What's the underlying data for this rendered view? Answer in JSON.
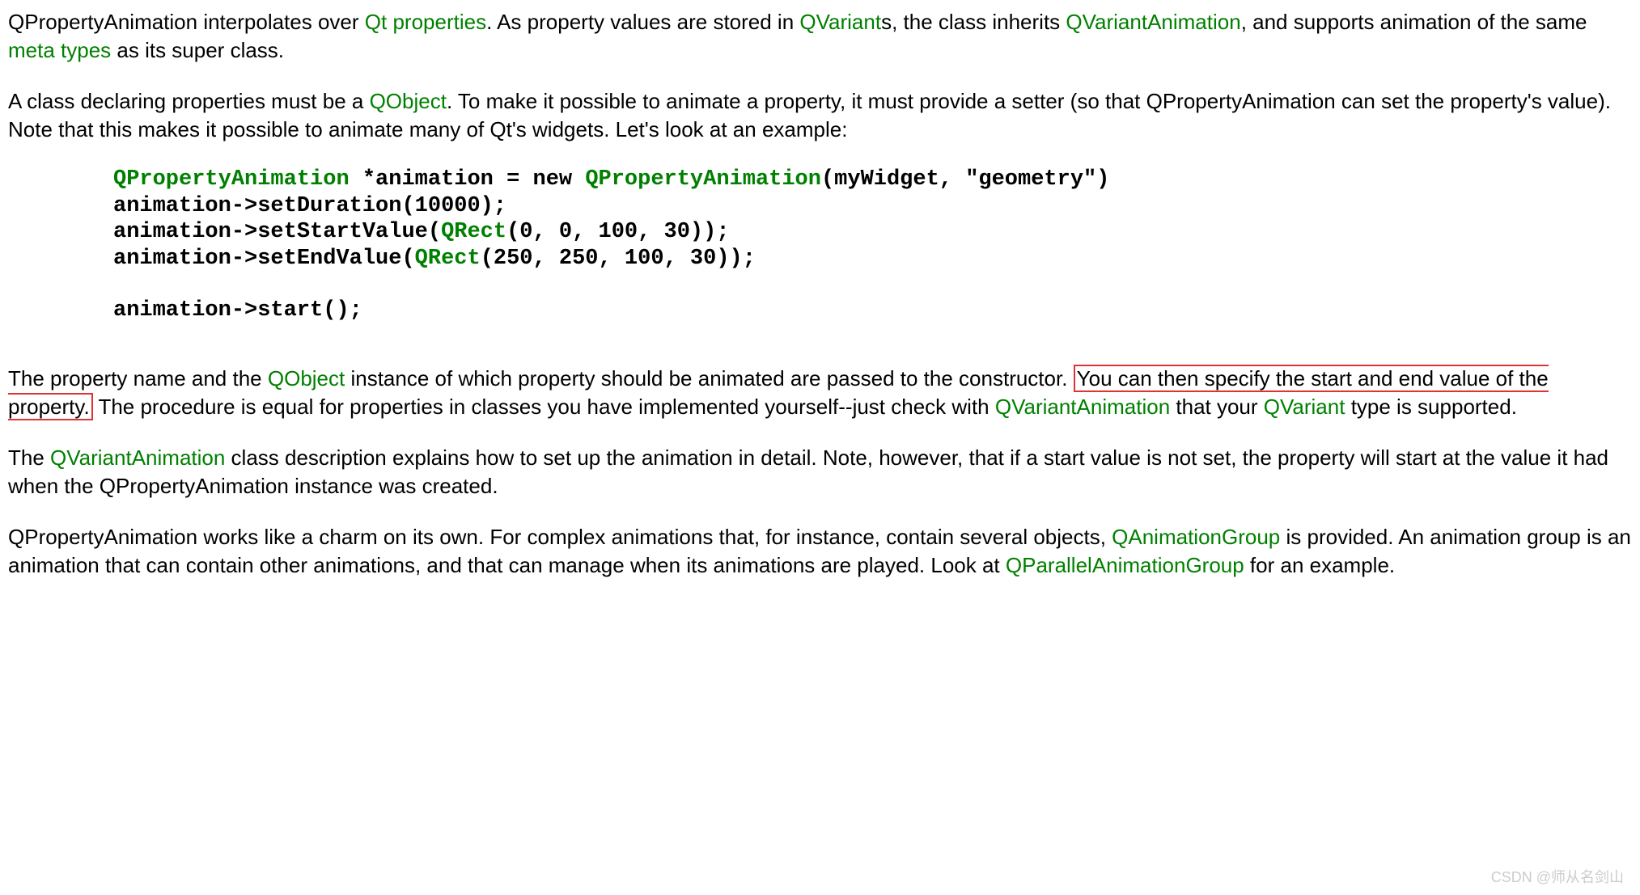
{
  "para1": {
    "t1": "QPropertyAnimation interpolates over ",
    "link1": "Qt properties",
    "t2": ". As property values are stored in ",
    "link2": "QVariant",
    "t3": "s, the class inherits ",
    "link3": "QVariantAnimation",
    "t4": ", and supports animation of the same ",
    "link4": "meta types",
    "t5": " as its super class."
  },
  "para2": {
    "t1": "A class declaring properties must be a ",
    "link1": "QObject",
    "t2": ". To make it possible to animate a property, it must provide a setter (so that QPropertyAnimation can set the property's value). Note that this makes it possible to animate many of Qt's widgets. Let's look at an example:"
  },
  "code": {
    "line1a": "QPropertyAnimation",
    "line1b": " *animation = new ",
    "line1c": "QPropertyAnimation",
    "line1d": "(myWidget, \"geometry\")",
    "line2": "animation->setDuration(10000);",
    "line3a": "animation->setStartValue(",
    "line3b": "QRect",
    "line3c": "(0, 0, 100, 30));",
    "line4a": "animation->setEndValue(",
    "line4b": "QRect",
    "line4c": "(250, 250, 100, 30));",
    "line5": "animation->start();"
  },
  "para3": {
    "t1": "The property name and the ",
    "link1": "QObject",
    "t2": " instance of which property should be animated are passed to the constructor. ",
    "boxed": "You can then specify the start and end value of the property.",
    "t3": " The procedure is equal for properties in classes you have implemented yourself--just check with ",
    "link2": "QVariantAnimation",
    "t4": " that your ",
    "link3": "QVariant",
    "t5": " type is supported."
  },
  "para4": {
    "t1": "The ",
    "link1": "QVariantAnimation",
    "t2": " class description explains how to set up the animation in detail. Note, however, that if a start value is not set, the property will start at the value it had when the QPropertyAnimation instance was created."
  },
  "para5": {
    "t1": "QPropertyAnimation works like a charm on its own. For complex animations that, for instance, contain several objects, ",
    "link1": "QAnimationGroup",
    "t2": " is provided. An animation group is an animation that can contain other animations, and that can manage when its animations are played. Look at ",
    "link2": "QParallelAnimationGroup",
    "t3": " for an example."
  },
  "watermark": "CSDN @师从名剑山"
}
